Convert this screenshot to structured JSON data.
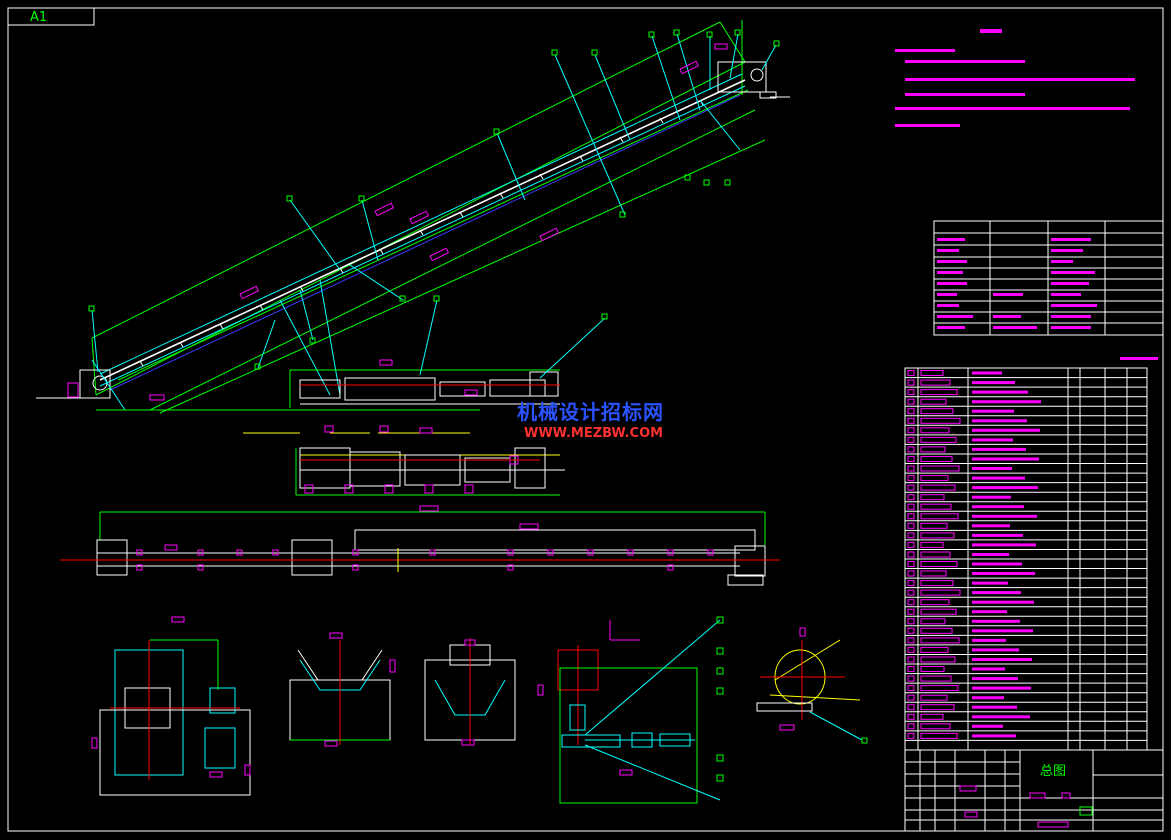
{
  "sheet": {
    "size_mark": "A1"
  },
  "watermark": {
    "line1": "机械设计招标网",
    "line2": "WWW.MEZBW.COM"
  },
  "title_block": {
    "drawing_title": "总图"
  },
  "colors": {
    "background": "#000000",
    "frame": "#ffffff",
    "green": "#00ff00",
    "cyan": "#00ffff",
    "magenta": "#ff00ff",
    "red": "#ff0000",
    "yellow": "#ffff00",
    "blue": "#3a3aff",
    "white": "#ffffff"
  }
}
